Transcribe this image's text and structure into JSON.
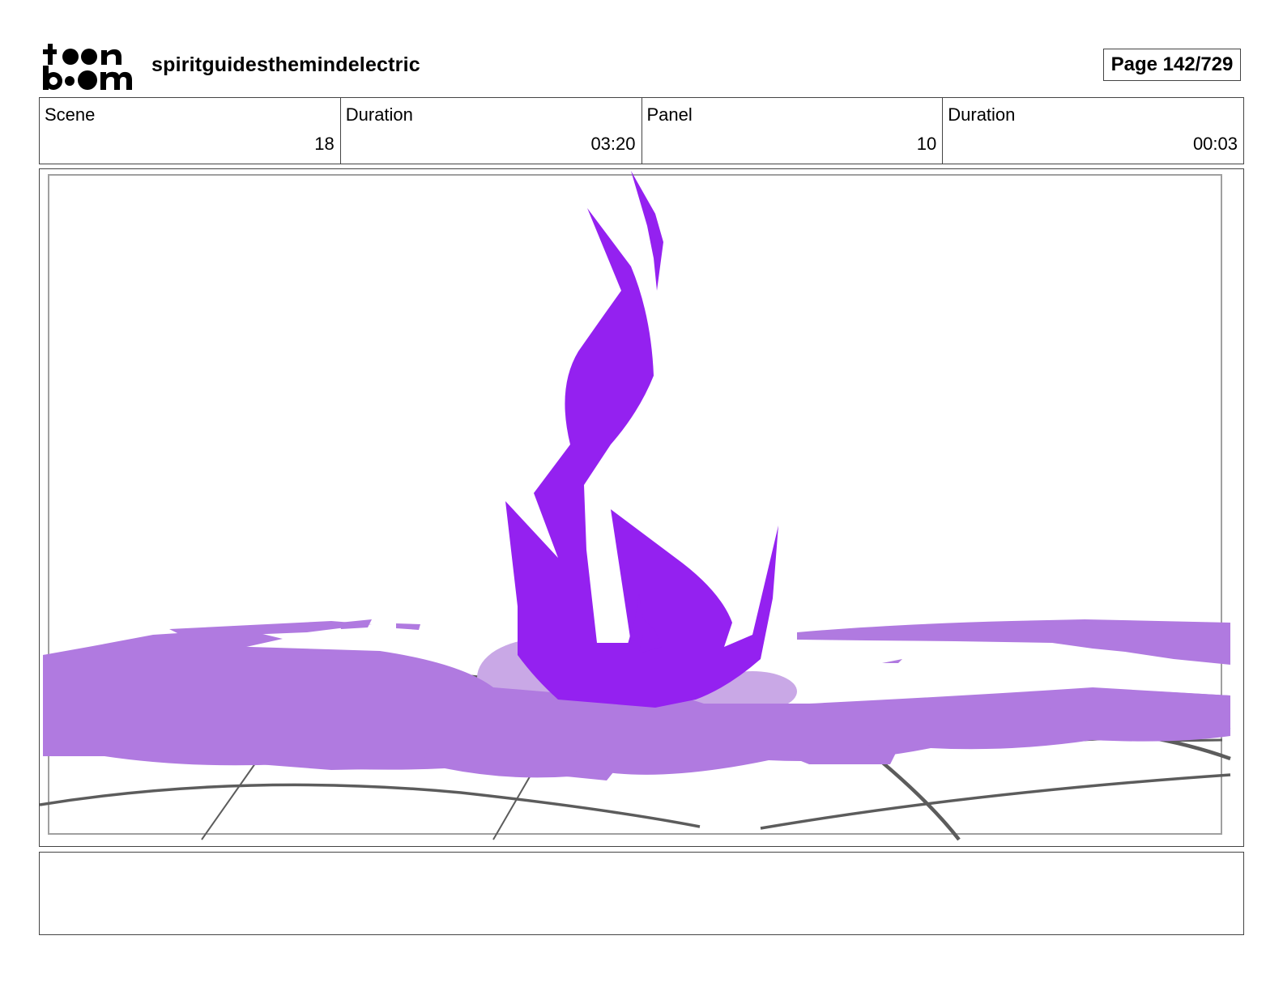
{
  "header": {
    "project_title": "spiritguidesthemindelectric",
    "page_label": "Page 142/729",
    "logo": {
      "line1": "toon",
      "line2": "boom",
      "icon": "toon-boom-logo"
    }
  },
  "info": {
    "scene_label": "Scene",
    "scene_value": "18",
    "scene_duration_label": "Duration",
    "scene_duration_value": "03:20",
    "panel_label": "Panel",
    "panel_value": "10",
    "panel_duration_label": "Duration",
    "panel_duration_value": "00:03"
  },
  "panel": {
    "colors": {
      "flame": "#9421f0",
      "ground_glow": "#b07ae0",
      "ground_glow_light": "#c9a8e6",
      "grid_lines": "#5c5c5c",
      "safe_frame": "#a0a0a0"
    }
  },
  "notes": {
    "text": ""
  }
}
